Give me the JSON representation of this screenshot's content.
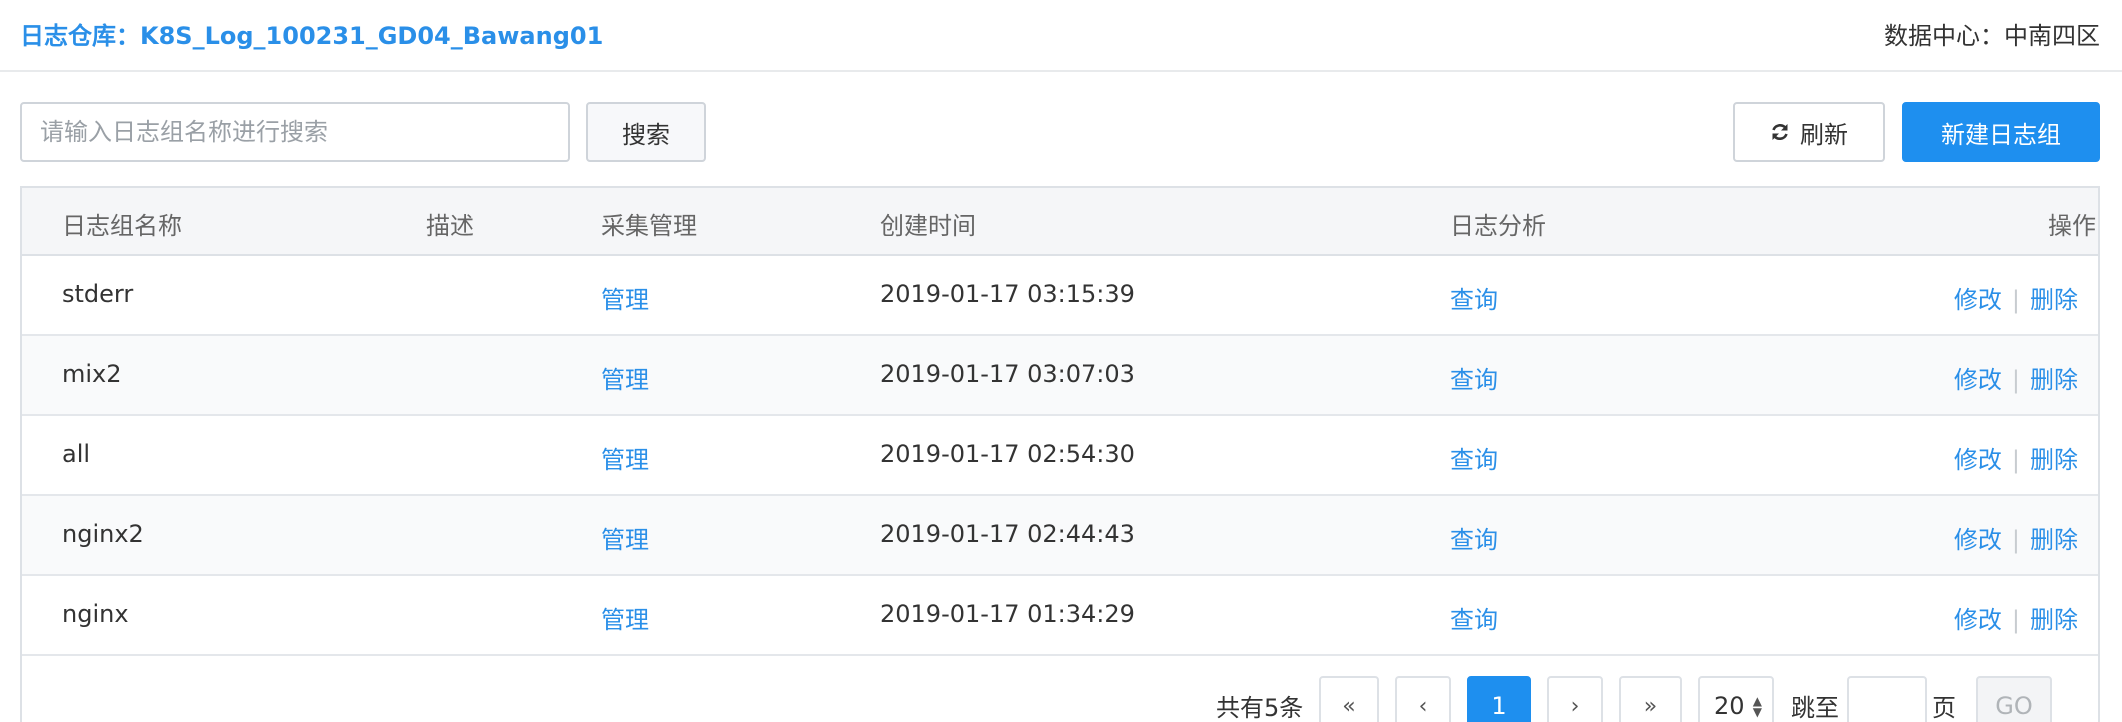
{
  "header": {
    "repo_title": "日志仓库：K8S_Log_100231_GD04_Bawang01",
    "datacenter": "数据中心：中南四区"
  },
  "toolbar": {
    "search_placeholder": "请输入日志组名称进行搜索",
    "search_value": "",
    "search_label": "搜索",
    "refresh_label": "刷新",
    "new_label": "新建日志组"
  },
  "table": {
    "columns": [
      "日志组名称",
      "描述",
      "采集管理",
      "创建时间",
      "日志分析",
      "操作"
    ],
    "rows": [
      {
        "name": "stderr",
        "desc": "",
        "collect": "管理",
        "created": "2019-01-17 03:15:39",
        "analysis": "查询",
        "edit": "修改",
        "delete": "删除"
      },
      {
        "name": "mix2",
        "desc": "",
        "collect": "管理",
        "created": "2019-01-17 03:07:03",
        "analysis": "查询",
        "edit": "修改",
        "delete": "删除"
      },
      {
        "name": "all",
        "desc": "",
        "collect": "管理",
        "created": "2019-01-17 02:54:30",
        "analysis": "查询",
        "edit": "修改",
        "delete": "删除"
      },
      {
        "name": "nginx2",
        "desc": "",
        "collect": "管理",
        "created": "2019-01-17 02:44:43",
        "analysis": "查询",
        "edit": "修改",
        "delete": "删除"
      },
      {
        "name": "nginx",
        "desc": "",
        "collect": "管理",
        "created": "2019-01-17 01:34:29",
        "analysis": "查询",
        "edit": "修改",
        "delete": "删除"
      }
    ],
    "separator": "|"
  },
  "pagination": {
    "total": "共有5条",
    "first": "«",
    "prev": "‹",
    "current": "1",
    "next": "›",
    "last": "»",
    "page_size": "20",
    "jump_label": "跳至",
    "page_unit": "页",
    "go_label": "GO"
  },
  "colors": {
    "accent": "#1e8fef",
    "link": "#2a8fe8"
  },
  "icons": {
    "refresh": "refresh-icon"
  }
}
